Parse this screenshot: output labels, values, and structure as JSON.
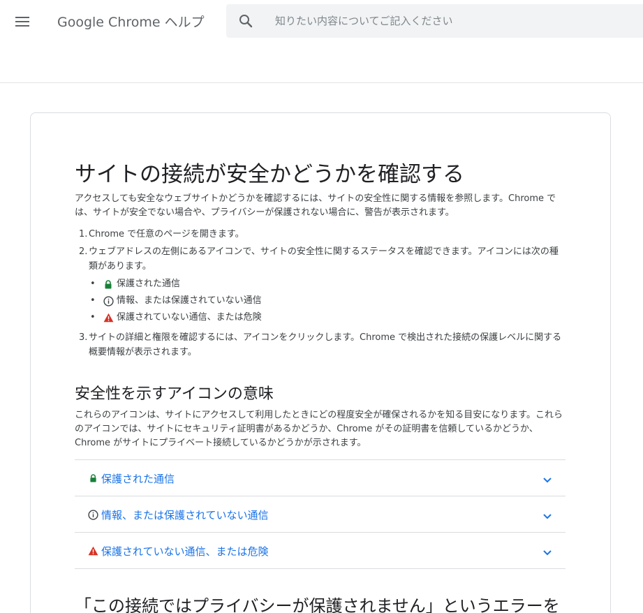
{
  "header": {
    "menu_icon": "hamburger-menu-icon",
    "product_title": "Google Chrome ヘルプ",
    "search": {
      "icon": "search-icon",
      "placeholder": "知りたい内容についてご記入ください",
      "value": ""
    }
  },
  "article": {
    "title": "サイトの接続が安全かどうかを確認する",
    "intro": "アクセスしても安全なウェブサイトかどうかを確認するには、サイトの安全性に関する情報を参照します。Chrome では、サイトが安全でない場合や、プライバシーが保護されない場合に、警告が表示されます。",
    "steps": [
      {
        "number": "1.",
        "text": "Chrome で任意のページを開きます。"
      },
      {
        "number": "2.",
        "text": "ウェブアドレスの左側にあるアイコンで、サイトの安全性に関するステータスを確認できます。アイコンには次の種類があります。",
        "bullets": [
          {
            "icon": "lock-icon",
            "text": "保護された通信"
          },
          {
            "icon": "info-icon",
            "text": "情報、または保護されていない通信"
          },
          {
            "icon": "warning-icon",
            "text": "保護されていない通信、または危険"
          }
        ]
      },
      {
        "number": "3.",
        "text": "サイトの詳細と権限を確認するには、アイコンをクリックします。Chrome で検出された接続の保護レベルに関する概要情報が表示されます。"
      }
    ],
    "section": {
      "title": "安全性を示すアイコンの意味",
      "description": "これらのアイコンは、サイトにアクセスして利用したときにどの程度安全が確保されるかを知る目安になります。これらのアイコンでは、サイトにセキュリティ証明書があるかどうか、Chrome がその証明書を信頼しているかどうか、Chrome がサイトにプライベート接続しているかどうかが示されます。",
      "accordion": [
        {
          "icon": "lock-icon",
          "label": "保護された通信"
        },
        {
          "icon": "info-icon",
          "label": "情報、または保護されていない通信"
        },
        {
          "icon": "warning-icon",
          "label": "保護されていない通信、または危険"
        }
      ]
    },
    "next_heading": "「この接続ではプライバシーが保護されません」というエラーを"
  },
  "colors": {
    "link": "#1a73e8",
    "secure_green": "#188038",
    "danger_red": "#d93025",
    "text_secondary": "#5f6368"
  }
}
